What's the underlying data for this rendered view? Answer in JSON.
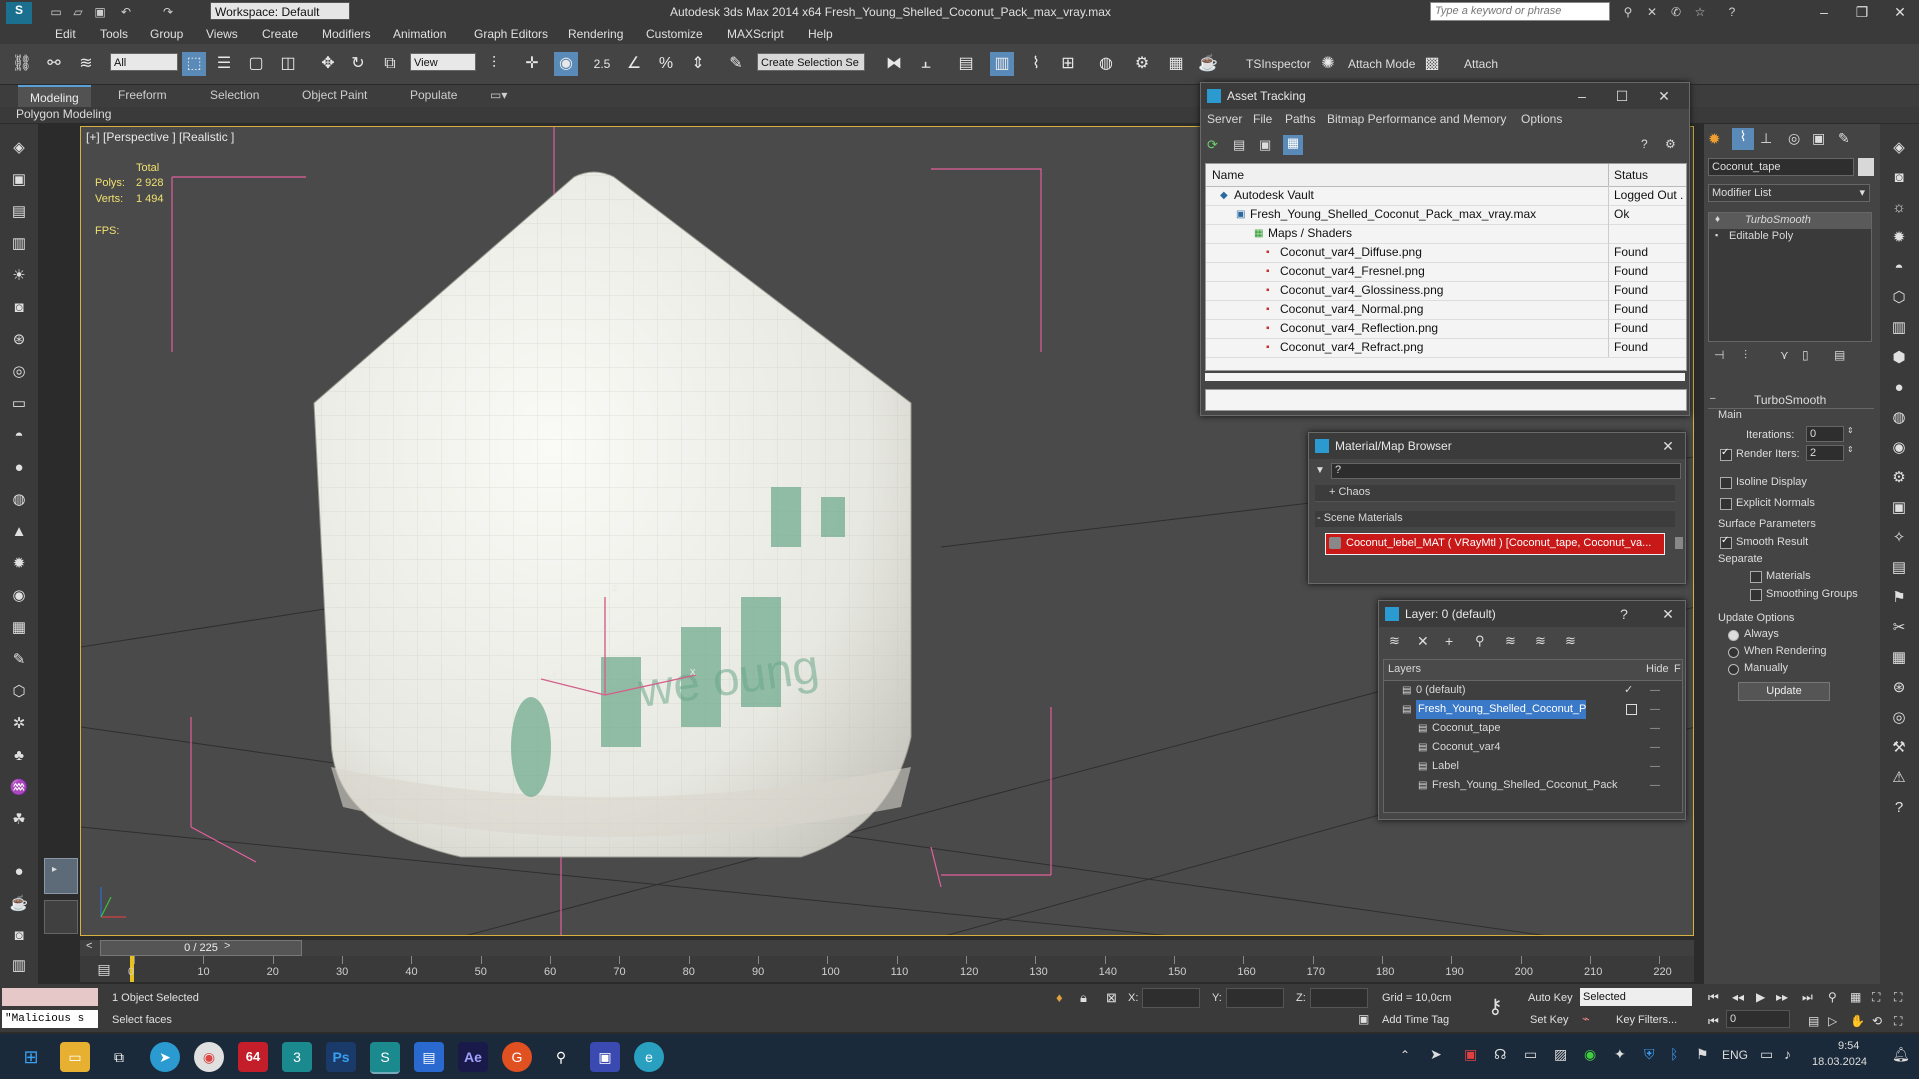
{
  "app": {
    "title": "Autodesk 3ds Max  2014 x64    Fresh_Young_Shelled_Coconut_Pack_max_vray.max",
    "workspace": "Workspace: Default",
    "search_placeholder": "Type a keyword or phrase"
  },
  "menu": [
    "Edit",
    "Tools",
    "Group",
    "Views",
    "Create",
    "Modifiers",
    "Animation",
    "Graph Editors",
    "Rendering",
    "Customize",
    "MAXScript",
    "Help"
  ],
  "toolbar": {
    "selection_filter": "All",
    "ref_coord": "View",
    "snap_value": "2.5",
    "named_selection": "Create Selection Se",
    "tsinspector": "TSInspector",
    "attach_mode": "Attach Mode",
    "attach": "Attach"
  },
  "ribbon": {
    "tabs": [
      "Modeling",
      "Freeform",
      "Selection",
      "Object Paint",
      "Populate"
    ],
    "active": "Modeling",
    "sub": "Polygon Modeling"
  },
  "viewport": {
    "label": "[+] [Perspective ] [Realistic ]",
    "stats": {
      "total": "Total",
      "polys_label": "Polys:",
      "polys": "2 928",
      "verts_label": "Verts:",
      "verts": "1 494",
      "fps_label": "FPS:"
    },
    "axis": {
      "z": "z",
      "x": "x",
      "y": "y"
    }
  },
  "asset_tracking": {
    "title": "Asset Tracking",
    "menu": [
      "Server",
      "File",
      "Paths",
      "Bitmap Performance and Memory",
      "Options"
    ],
    "columns": [
      "Name",
      "Status"
    ],
    "rows": [
      {
        "name": "Autodesk Vault",
        "status": "Logged Out ."
      },
      {
        "name": "Fresh_Young_Shelled_Coconut_Pack_max_vray.max",
        "status": "Ok"
      },
      {
        "name": "Maps / Shaders",
        "status": ""
      },
      {
        "name": "Coconut_var4_Diffuse.png",
        "status": "Found"
      },
      {
        "name": "Coconut_var4_Fresnel.png",
        "status": "Found"
      },
      {
        "name": "Coconut_var4_Glossiness.png",
        "status": "Found"
      },
      {
        "name": "Coconut_var4_Normal.png",
        "status": "Found"
      },
      {
        "name": "Coconut_var4_Reflection.png",
        "status": "Found"
      },
      {
        "name": "Coconut_var4_Refract.png",
        "status": "Found"
      }
    ]
  },
  "material_browser": {
    "title": "Material/Map Browser",
    "search": "?",
    "group_chaos": "+ Chaos",
    "group_scene": "- Scene Materials",
    "material": "Coconut_lebel_MAT ( VRayMtl ) [Coconut_tape, Coconut_va..."
  },
  "layer_dialog": {
    "title": "Layer: 0 (default)",
    "help": "?",
    "columns": [
      "Layers",
      "Hide",
      "F"
    ],
    "rows": [
      {
        "name": "0 (default)",
        "level": 0
      },
      {
        "name": "Fresh_Young_Shelled_Coconut_Pack",
        "level": 0,
        "selected": true
      },
      {
        "name": "Coconut_tape",
        "level": 1
      },
      {
        "name": "Coconut_var4",
        "level": 1
      },
      {
        "name": "Label",
        "level": 1
      },
      {
        "name": "Fresh_Young_Shelled_Coconut_Pack",
        "level": 1
      }
    ]
  },
  "command_panel": {
    "object_name": "Coconut_tape",
    "modifier_list": "Modifier List",
    "stack": [
      "TurboSmooth",
      "Editable Poly"
    ],
    "rollout_title": "TurboSmooth",
    "main_label": "Main",
    "iterations_label": "Iterations:",
    "iterations": "0",
    "render_iters_label": "Render Iters:",
    "render_iters": "2",
    "isoline": "Isoline Display",
    "explicit_normals": "Explicit Normals",
    "surface_params": "Surface Parameters",
    "smooth_result": "Smooth Result",
    "separate": "Separate",
    "materials": "Materials",
    "smoothing_groups": "Smoothing Groups",
    "update_options": "Update Options",
    "always": "Always",
    "when_rendering": "When Rendering",
    "manually": "Manually",
    "update_btn": "Update"
  },
  "timeline": {
    "frame": "0 / 225",
    "ticks": [
      "0",
      "10",
      "20",
      "30",
      "40",
      "50",
      "60",
      "70",
      "80",
      "90",
      "100",
      "110",
      "120",
      "130",
      "140",
      "150",
      "160",
      "170",
      "180",
      "190",
      "200",
      "210",
      "220"
    ]
  },
  "status": {
    "script": "\"Malicious s",
    "selected": "1 Object Selected",
    "prompt": "Select faces",
    "x": "X:",
    "y": "Y:",
    "z": "Z:",
    "grid": "Grid = 10,0cm",
    "add_time_tag": "Add Time Tag",
    "auto_key": "Auto Key",
    "auto_key_mode": "Selected",
    "set_key": "Set Key",
    "key_filters": "Key Filters...",
    "current_frame": "0"
  },
  "taskbar": {
    "lang": "ENG",
    "time": "9:54",
    "date": "18.03.2024",
    "badge": "64"
  }
}
